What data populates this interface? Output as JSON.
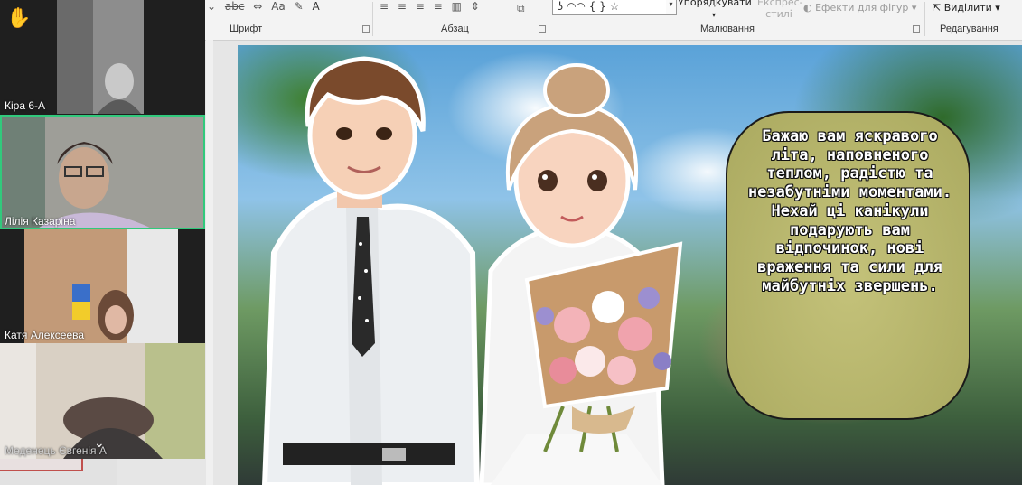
{
  "ribbon": {
    "groups": {
      "font": "Шрифт",
      "paragraph": "Абзац",
      "drawing": "Малювання",
      "editing": "Редагування"
    },
    "font_tools": [
      "abc",
      "Aa"
    ],
    "arrange_label": "Упорядкувати",
    "quick_styles_label": "Експрес-стилі",
    "shape_effects_label": "Ефекти для фігур",
    "select_label": "Виділити",
    "shapes_glyphs": "ʖ ◠◠ { } ☆"
  },
  "video_call": {
    "participants": [
      {
        "name": "Кіра 6-А",
        "hand_raised": true
      },
      {
        "name": "Лілія Казаріна",
        "active_speaker": true
      },
      {
        "name": "Катя Алексеева"
      },
      {
        "name": "Меденець Євгенія А"
      }
    ],
    "raise_hand_icon": "raised-hand",
    "active_color": "#31c97c"
  },
  "slide": {
    "wish_text": "Бажаю вам яскравого літа, наповненого теплом, радістю та незабутніми моментами. Нехай ці канікули подарують вам відпочинок, нові враження та сили для майбутніх звершень.",
    "bubble_color": "#b5b46a"
  }
}
